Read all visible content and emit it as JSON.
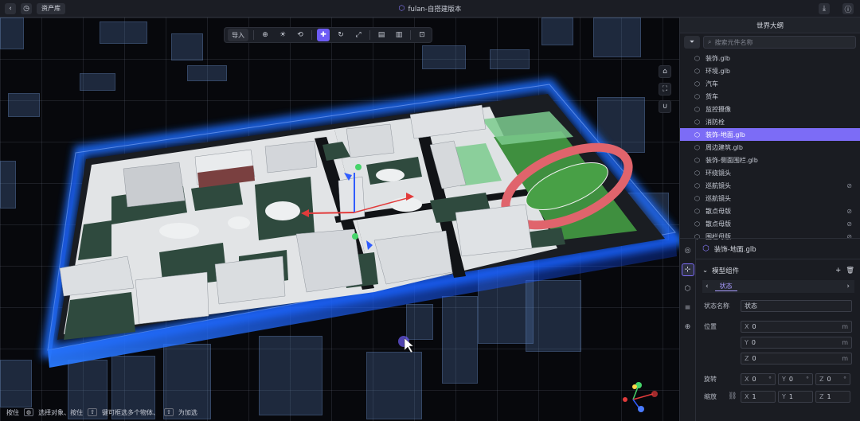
{
  "topbar": {
    "back_icon": "chevron-left-icon",
    "history_icon": "clock-icon",
    "asset_library": "资产库",
    "title": "fulan-自搭建版本",
    "download_icon": "download-icon",
    "info_icon": "info-icon"
  },
  "toolbar": {
    "import_label": "导入",
    "tools": [
      "add-object-icon",
      "bulb-icon",
      "loop-icon",
      "move-icon",
      "rotate-icon",
      "scale-icon",
      "align-icon",
      "snap-icon",
      "lock-icon"
    ]
  },
  "status": {
    "text1": "按住",
    "text2": "选择对象、按住",
    "text3": "键可框选多个物体、",
    "text4": "为加选"
  },
  "outline": {
    "title": "世界大纲",
    "search_placeholder": "搜索元件名称",
    "items": [
      {
        "label": "装饰.glb",
        "selected": false,
        "hidden": false
      },
      {
        "label": "环境.glb",
        "selected": false,
        "hidden": false
      },
      {
        "label": "汽车",
        "selected": false,
        "hidden": false
      },
      {
        "label": "货车",
        "selected": false,
        "hidden": false
      },
      {
        "label": "监控摄像",
        "selected": false,
        "hidden": false
      },
      {
        "label": "消防栓",
        "selected": false,
        "hidden": false
      },
      {
        "label": "装饰-地面.glb",
        "selected": true,
        "hidden": false
      },
      {
        "label": "周边建筑.glb",
        "selected": false,
        "hidden": false
      },
      {
        "label": "装饰-侧面围栏.glb",
        "selected": false,
        "hidden": false
      },
      {
        "label": "环绕镜头",
        "selected": false,
        "hidden": false
      },
      {
        "label": "巡航镜头",
        "selected": false,
        "hidden": true
      },
      {
        "label": "巡航镜头",
        "selected": false,
        "hidden": false
      },
      {
        "label": "散点母版",
        "selected": false,
        "hidden": true
      },
      {
        "label": "散点母版",
        "selected": false,
        "hidden": true
      },
      {
        "label": "围栏母版",
        "selected": false,
        "hidden": true
      }
    ]
  },
  "inspector": {
    "object_name": "装饰-地面.glb",
    "component_title": "模型组件",
    "state_tab": "状态",
    "state_name_label": "状态名称",
    "state_name_value": "状态",
    "position_label": "位置",
    "position": {
      "x": "0",
      "y": "0",
      "z": "0",
      "unit": "m"
    },
    "rotation_label": "旋转",
    "rotation": {
      "x": "0",
      "y": "0",
      "z": "0",
      "unit": "°"
    },
    "scale_label": "缩放",
    "scale": {
      "x": "1",
      "y": "1",
      "z": "1"
    }
  },
  "colors": {
    "accent": "#7c6cf6",
    "glow": "#1f6dff",
    "ground": "#e4e6e8",
    "track": "#e0646c",
    "field": "#3f8f3f"
  }
}
